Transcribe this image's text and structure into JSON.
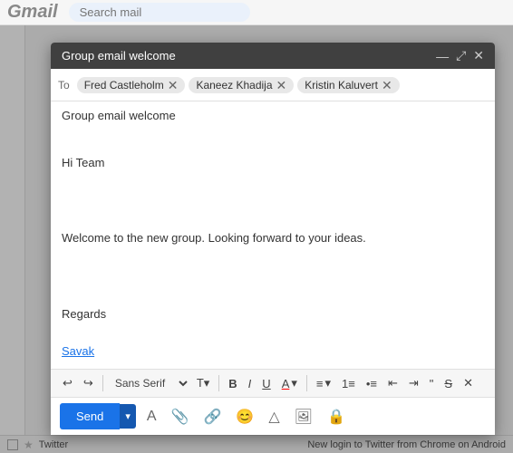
{
  "app": {
    "title": "Gmail",
    "search_placeholder": "Search mail"
  },
  "compose": {
    "header_title": "Group email welcome",
    "to_label": "To",
    "recipients": [
      {
        "name": "Fred Castleholm",
        "id": "fred"
      },
      {
        "name": "Kaneez Khadija",
        "id": "kaneez"
      },
      {
        "name": "Kristin Kaluvert",
        "id": "kristin"
      }
    ],
    "subject": "Group email welcome",
    "body_line1": "Hi Team",
    "body_line2": "",
    "body_line3": "Welcome to the new group. Looking forward to your ideas.",
    "body_line4": "",
    "body_line5": "Regards",
    "signature_name": "Savak"
  },
  "toolbar": {
    "undo_label": "↩",
    "redo_label": "↪",
    "font_label": "Sans Serif",
    "font_size_label": "▾",
    "bold_label": "B",
    "italic_label": "I",
    "underline_label": "U",
    "text_color_label": "A",
    "align_label": "≡",
    "numbered_list_label": "⋮",
    "bullet_list_label": "⋮",
    "indent_label": "⇥",
    "outdent_label": "⇤",
    "quote_label": "❝",
    "strikethrough_label": "S̶",
    "remove_format_label": "✕"
  },
  "actions": {
    "send_label": "Send",
    "send_dropdown_label": "▾"
  },
  "status_bar": {
    "notification": "New login to Twitter from Chrome on Android"
  }
}
